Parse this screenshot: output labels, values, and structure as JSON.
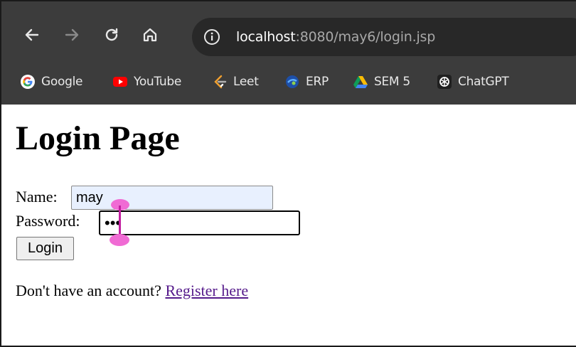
{
  "browser": {
    "url_host": "localhost",
    "url_rest": ":8080/may6/login.jsp",
    "bookmarks": [
      {
        "label": "Google",
        "icon": "google-icon"
      },
      {
        "label": "YouTube",
        "icon": "youtube-icon"
      },
      {
        "label": "Leet",
        "icon": "leetcode-icon"
      },
      {
        "label": "ERP",
        "icon": "erp-icon"
      },
      {
        "label": "SEM 5",
        "icon": "google-drive-icon"
      },
      {
        "label": "ChatGPT",
        "icon": "chatgpt-icon"
      }
    ],
    "colors": {
      "toolbar": "#3c3c3c",
      "omnibox": "#282828"
    }
  },
  "page": {
    "title": "Login Page",
    "name_label": "Name:",
    "name_value": "may",
    "password_label": "Password:",
    "password_value": "•••",
    "login_button": "Login",
    "register_prompt": "Don't have an account?",
    "register_link": "Register here",
    "colors": {
      "autofill": "#e8f0fe",
      "visited_link": "#551a8b"
    }
  }
}
